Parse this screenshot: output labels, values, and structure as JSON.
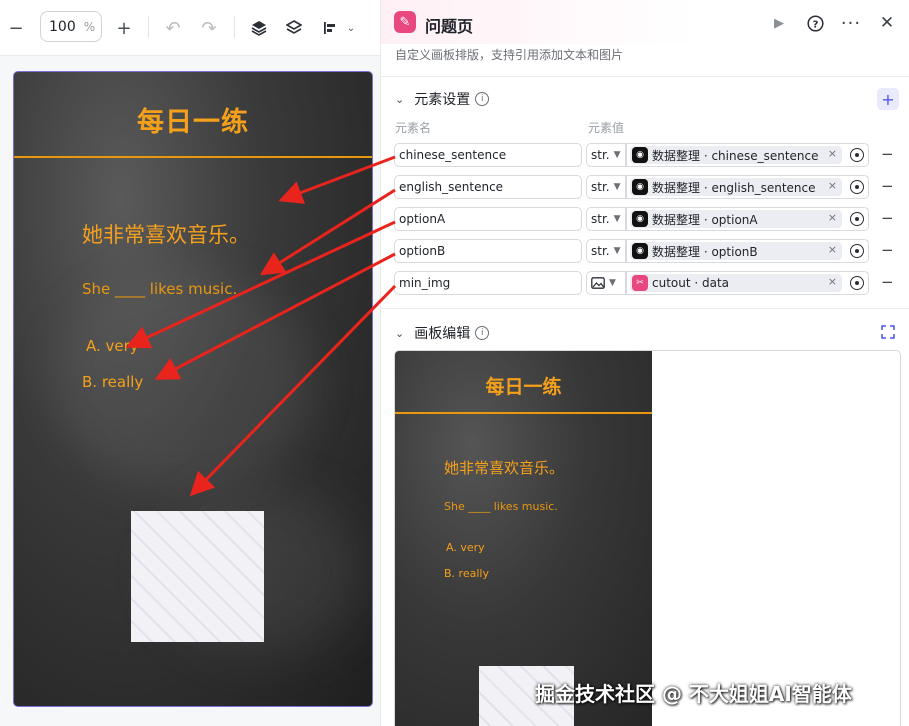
{
  "toolbar": {
    "zoom_value": "100",
    "zoom_unit": "%"
  },
  "canvas": {
    "title": "每日一练",
    "chinese_sentence": "她非常喜欢音乐。",
    "english_sentence": "She ____ likes music.",
    "optionA": "A. very",
    "optionB": "B. really",
    "accent_color": "#f5a01a"
  },
  "panel": {
    "title": "问题页",
    "subtitle": "自定义画板排版，支持引用添加文本和图片",
    "elements_section": "元素设置",
    "col_name": "元素名",
    "col_value": "元素值",
    "canvas_section": "画板编辑",
    "rows": [
      {
        "name": "chinese_sentence",
        "type": "str.",
        "ref": "数据整理 · chinese_sentence"
      },
      {
        "name": "english_sentence",
        "type": "str.",
        "ref": "数据整理 · english_sentence"
      },
      {
        "name": "optionA",
        "type": "str.",
        "ref": "数据整理 · optionA"
      },
      {
        "name": "optionB",
        "type": "str.",
        "ref": "数据整理 · optionB"
      },
      {
        "name": "min_img",
        "type": "",
        "ref": "cutout · data"
      }
    ]
  },
  "preview": {
    "title": "每日一练",
    "chinese_sentence": "她非常喜欢音乐。",
    "english_sentence": "She ____ likes music.",
    "optionA": "A. very",
    "optionB": "B. really"
  },
  "watermark": "掘金技术社区 @ 不大姐姐AI智能体",
  "icons": {
    "app": "edit-note-icon",
    "run": "play-icon",
    "help": "help-icon",
    "more": "more-icon",
    "close": "close-icon"
  }
}
